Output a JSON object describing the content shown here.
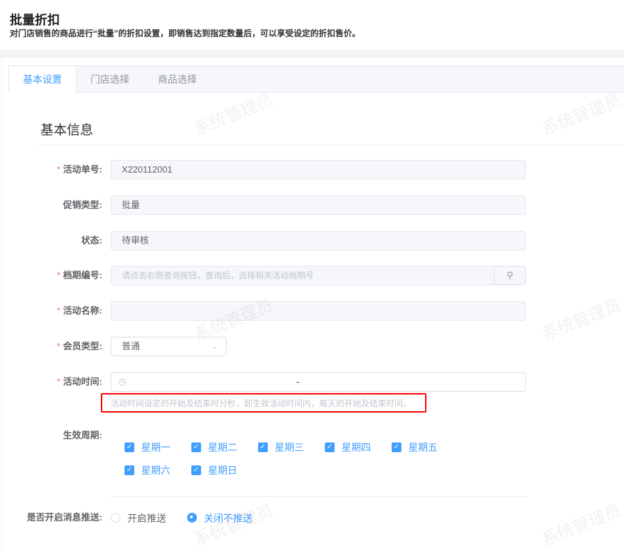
{
  "header": {
    "title": "批量折扣",
    "subtitle": "对门店销售的商品进行“批量”的折扣设置，即销售达到指定数量后，可以享受设定的折扣售价。"
  },
  "tabs": [
    {
      "label": "基本设置",
      "active": true
    },
    {
      "label": "门店选择"
    },
    {
      "label": "商品选择"
    }
  ],
  "section_title": "基本信息",
  "form": {
    "activity_no": {
      "label": "活动单号:",
      "value": "X220112001"
    },
    "promo_type": {
      "label": "促销类型:",
      "value": "批量"
    },
    "status": {
      "label": "状态:",
      "value": "待审核"
    },
    "schedule_no": {
      "label": "档期编号:",
      "placeholder": "请点击右侧查询按钮，查询后，选择相关活动档期号"
    },
    "activity_name": {
      "label": "活动名称:",
      "value": ""
    },
    "member_type": {
      "label": "会员类型:",
      "value": "普通"
    },
    "activity_time": {
      "label": "活动时间:",
      "separator": "-",
      "hint": "活动时间设定的开始及结束时分秒，即生效活动时间内，每天的开始及结束时间。"
    },
    "period": {
      "label": "生效周期:",
      "days": [
        "星期一",
        "星期二",
        "星期三",
        "星期四",
        "星期五",
        "星期六",
        "星期日"
      ]
    },
    "push": {
      "label": "是否开启消息推送:",
      "options": [
        "开启推送",
        "关闭不推送"
      ],
      "selected": "关闭不推送"
    }
  },
  "watermark": "系统管理员",
  "colors": {
    "primary": "#409eff",
    "required": "#f56c6c",
    "highlight_box": "#ff0000"
  }
}
